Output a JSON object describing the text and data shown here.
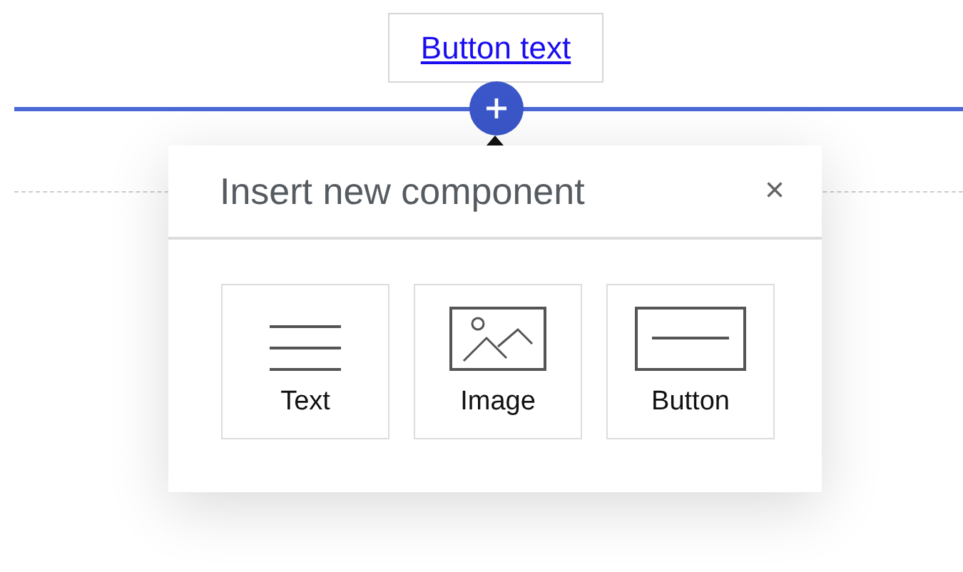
{
  "link_button": {
    "label": "Button text"
  },
  "dialog": {
    "title": "Insert new component",
    "close": "×",
    "components": [
      {
        "kind": "text",
        "label": "Text"
      },
      {
        "kind": "image",
        "label": "Image"
      },
      {
        "kind": "button",
        "label": "Button"
      }
    ]
  }
}
